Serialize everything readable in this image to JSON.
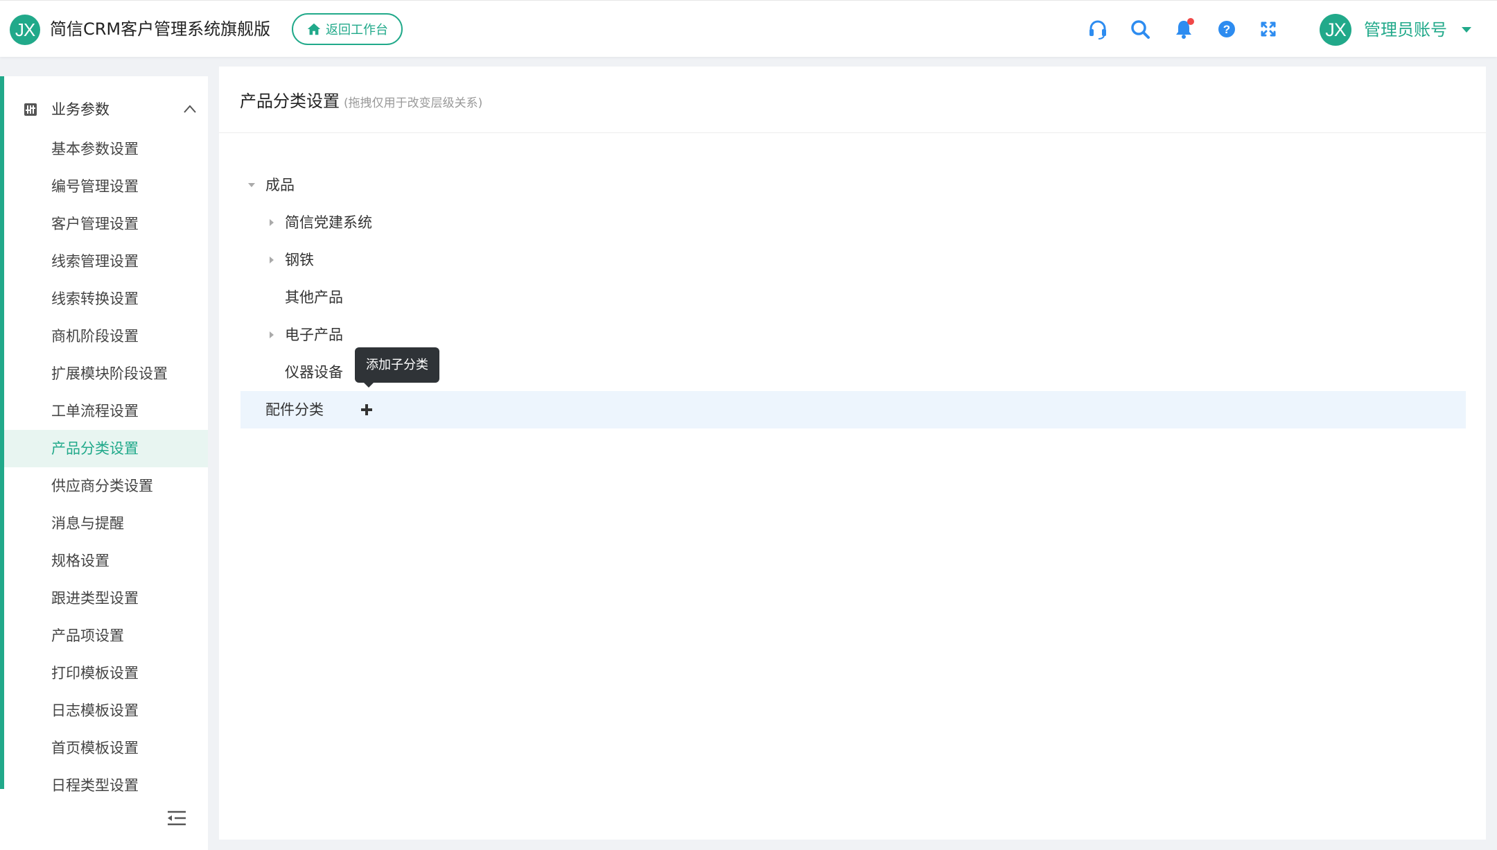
{
  "header": {
    "logo_text": "JX",
    "app_title": "简信CRM客户管理系统旗舰版",
    "back_button_label": "返回工作台",
    "icons": [
      "headset-icon",
      "search-icon",
      "bell-icon",
      "help-icon",
      "fullscreen-icon"
    ],
    "has_notification": true,
    "user": {
      "avatar_text": "JX",
      "name": "管理员账号"
    }
  },
  "sidebar": {
    "group": {
      "label": "业务参数",
      "expanded": true
    },
    "items": [
      {
        "label": "基本参数设置"
      },
      {
        "label": "编号管理设置"
      },
      {
        "label": "客户管理设置"
      },
      {
        "label": "线索管理设置"
      },
      {
        "label": "线索转换设置"
      },
      {
        "label": "商机阶段设置"
      },
      {
        "label": "扩展模块阶段设置"
      },
      {
        "label": "工单流程设置"
      },
      {
        "label": "产品分类设置",
        "active": true
      },
      {
        "label": "供应商分类设置"
      },
      {
        "label": "消息与提醒"
      },
      {
        "label": "规格设置"
      },
      {
        "label": "跟进类型设置"
      },
      {
        "label": "产品项设置"
      },
      {
        "label": "打印模板设置"
      },
      {
        "label": "日志模板设置"
      },
      {
        "label": "首页模板设置"
      },
      {
        "label": "日程类型设置"
      }
    ]
  },
  "main": {
    "title": "产品分类设置",
    "hint": "(拖拽仅用于改变层级关系)",
    "tree": [
      {
        "label": "成品",
        "level": 0,
        "caret": "expanded"
      },
      {
        "label": "简信党建系统",
        "level": 1,
        "caret": "collapsed"
      },
      {
        "label": "钢铁",
        "level": 1,
        "caret": "collapsed"
      },
      {
        "label": "其他产品",
        "level": 1,
        "caret": "none"
      },
      {
        "label": "电子产品",
        "level": 1,
        "caret": "collapsed"
      },
      {
        "label": "仪器设备",
        "level": 1,
        "caret": "none"
      },
      {
        "label": "配件分类",
        "level": 0,
        "caret": "none",
        "selected": true
      }
    ],
    "tooltip": "添加子分类"
  },
  "colors": {
    "accent": "#21a98a",
    "icon_blue": "#2d8cf0",
    "notification": "#f04848",
    "selected_row": "#edf5fd",
    "active_menu_bg": "#e8f5f1"
  }
}
